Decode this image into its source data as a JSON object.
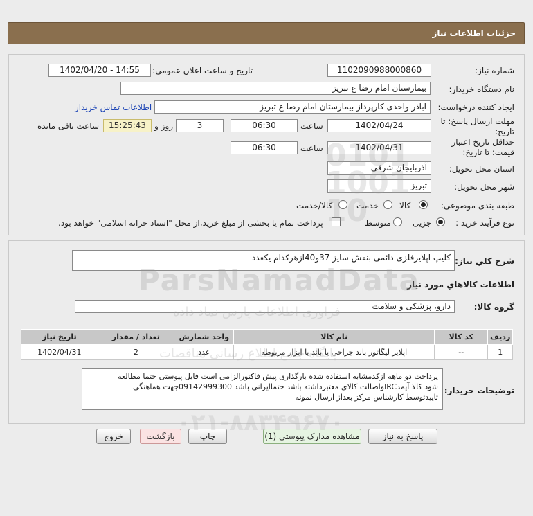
{
  "header": {
    "title": "جزئیات اطلاعات نیاز"
  },
  "fields": {
    "need_number_label": "شماره نیاز:",
    "need_number": "1102090988000860",
    "announce_label": "تاریخ و ساعت اعلان عمومی:",
    "announce_value": "1402/04/20 - 14:55",
    "buyer_label": "نام دستگاه خریدار:",
    "buyer_value": "بیمارستان امام رضا  ع  تبریز",
    "requester_label": "ایجاد کننده درخواست:",
    "requester_value": "اباذر واحدی کارپرداز بیمارستان امام رضا  ع  تبریز",
    "contact_link": "اطلاعات تماس خریدار",
    "deadline_label": "مهلت ارسال پاسخ: تا تاریخ:",
    "deadline_date": "1402/04/24",
    "time_label": "ساعت",
    "deadline_time": "06:30",
    "days_value": "3",
    "days_label": "روز و",
    "remaining_time": "15:25:43",
    "remaining_label": "ساعت باقی مانده",
    "validity_label": "حداقل تاریخ اعتبار قیمت: تا تاریخ:",
    "validity_date": "1402/04/31",
    "validity_time": "06:30",
    "province_label": "استان محل تحویل:",
    "province_value": "آذربایجان شرقی",
    "city_label": "شهر محل تحویل:",
    "city_value": "تبریز",
    "category_label": "طبقه بندی موضوعی:",
    "category_options": [
      "کالا",
      "خدمت",
      "کالا/خدمت"
    ],
    "category_selected": 0,
    "process_label": "نوع فرآیند خرید :",
    "process_options": [
      "جزیی",
      "متوسط"
    ],
    "process_selected": 0,
    "payment_text": "پرداخت تمام یا بخشی از مبلغ خرید،از محل \"اسناد خزانه اسلامی\" خواهد بود."
  },
  "summary": {
    "label": "شرح کلي نياز:",
    "value": "کلیپ اپلایرفلزی دائمی بنفش سایز 37و40ازهرکدام یکعدد"
  },
  "goods": {
    "section_title": "اطلاعات کالاهاي مورد نياز",
    "group_label": "گروه کالا:",
    "group_value": "دارو، پزشکی و سلامت",
    "columns": [
      "ردیف",
      "کد کالا",
      "نام کالا",
      "واحد شمارش",
      "تعداد / مقدار",
      "تاریخ نیاز"
    ],
    "rows": [
      [
        "1",
        "--",
        "اپلایر لیگاتور باند جراحی یا باند یا ابزار مربوطه",
        "عدد",
        "2",
        "1402/04/31"
      ]
    ]
  },
  "buyer_notes": {
    "label": "توضیحات خریدار:",
    "lines": [
      "پرداخت دو ماهه ازکدمشابه استفاده شده بارگذاری پیش فاکتورالزامی است فایل پیوستی حتما مطالعه",
      "شود کالا آیمدIRCواصالت کالای معتبرداشته باشد حتماایرانی باشد 09142999300جهت هماهنگی",
      "تاییدتوسط کارشناس مرکز بعداز ارسال نمونه"
    ]
  },
  "buttons": {
    "reply": "پاسخ به نیاز",
    "attachments": "مشاهده مدارک پیوستی (1)",
    "print": "چاپ",
    "back": "بازگشت",
    "exit": "خروج"
  },
  "watermark": {
    "brand": "ParsNamadData",
    "line1": "فراوری اطلاعات پارس نماد داده",
    "line2": "پایگاه جامع اطلاع رسانی مناقصات",
    "digits": "0101\n1001\n10",
    "phone": "۰۲۱-۸۸۳۴۹۶۷۰"
  }
}
